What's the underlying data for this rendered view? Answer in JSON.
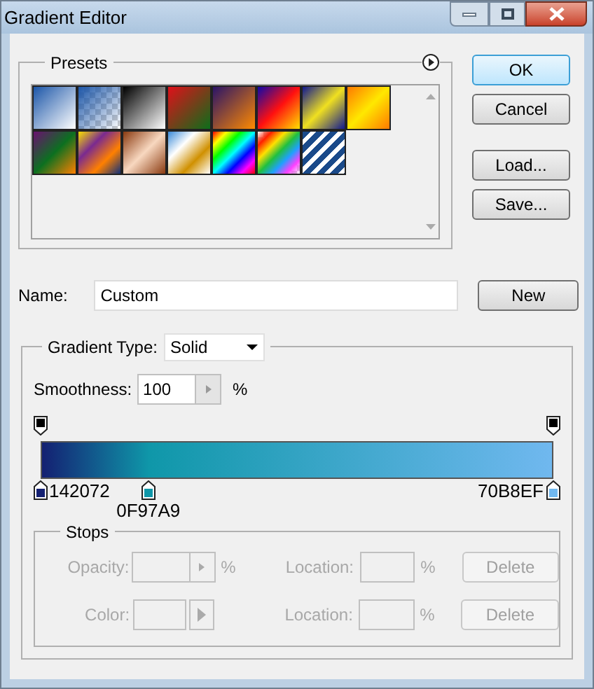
{
  "window": {
    "title": "Gradient Editor"
  },
  "presets": {
    "label": "Presets"
  },
  "buttons": [
    {
      "label": "OK",
      "default": true
    },
    {
      "label": "Cancel",
      "default": false
    },
    {
      "label": "Load...",
      "default": false
    },
    {
      "label": "Save...",
      "default": false
    }
  ],
  "name": {
    "label": "Name:",
    "value": "Custom",
    "button": "New"
  },
  "gradient": {
    "type_label": "Gradient Type:",
    "type_value": "Solid",
    "smoothness_label": "Smoothness:",
    "smoothness_value": "100",
    "smoothness_unit": "%",
    "opacity_stops": [
      {
        "level": 0,
        "color": "#000000"
      },
      {
        "level": 1,
        "color": "#000000"
      }
    ],
    "color_stops": [
      {
        "level": 0,
        "color": "#142072",
        "label": "142072"
      },
      {
        "level": 0.21,
        "color": "#0f97a9",
        "label": "0F97A9"
      },
      {
        "level": 1,
        "color": "#70b8ef",
        "label": "70B8EF"
      }
    ]
  },
  "stops": {
    "label": "Stops",
    "rows": [
      {
        "kind": "opacity",
        "label": "Opacity:",
        "unit": "%",
        "location_label": "Location:",
        "location_unit": "%",
        "delete": "Delete",
        "disabled": true
      },
      {
        "kind": "color",
        "label": "Color:",
        "location_label": "Location:",
        "location_unit": "%",
        "delete": "Delete",
        "disabled": true
      }
    ]
  }
}
